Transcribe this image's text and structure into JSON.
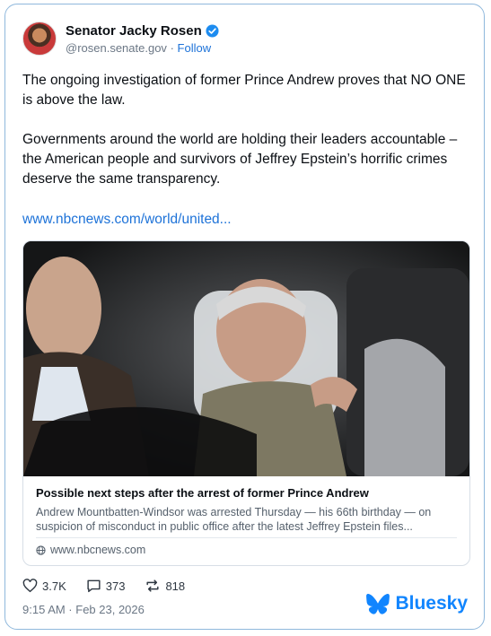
{
  "author": {
    "name": "Senator Jacky Rosen",
    "handle": "@rosen.senate.gov",
    "separator": "·",
    "follow_label": "Follow"
  },
  "post": {
    "paragraph_1": "The ongoing investigation of former Prince Andrew proves that NO ONE is above the law.",
    "paragraph_2": "Governments around the world are holding their leaders accountable – the American people and survivors of Jeffrey Epstein’s horrific crimes deserve the same transparency.",
    "link_text": "www.nbcnews.com/world/united..."
  },
  "embed": {
    "title": "Possible next steps after the arrest of former Prince Andrew",
    "description": "Andrew Mountbatten-Windsor was arrested Thursday — his 66th birthday — on suspicion of misconduct in public office after the latest Jeffrey Epstein files...",
    "domain": "www.nbcnews.com"
  },
  "stats": {
    "likes": "3.7K",
    "replies": "373",
    "reposts": "818"
  },
  "timestamp": "9:15 AM · Feb 23, 2026",
  "brand": {
    "name": "Bluesky",
    "color": "#1185fe"
  },
  "colors": {
    "link": "#1d72d8",
    "border": "#8fb8dc",
    "verified": "#1d8cf0"
  }
}
